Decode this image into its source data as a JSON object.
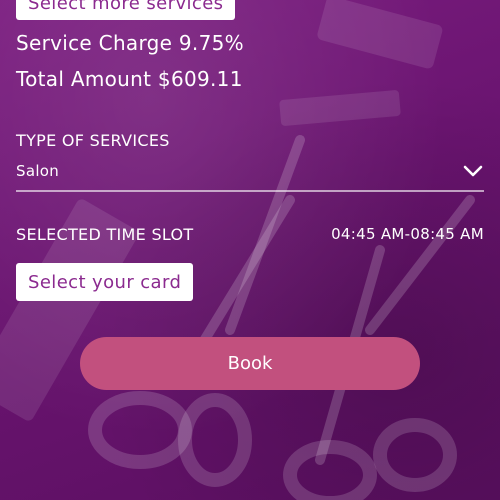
{
  "top_button": {
    "label": "Select more services"
  },
  "summary": {
    "service_charge": "Service Charge 9.75%",
    "total_amount": "Total Amount $609.11"
  },
  "services": {
    "label": "TYPE OF SERVICES",
    "selected": "Salon",
    "icon": "chevron-down-icon"
  },
  "time_slot": {
    "label": "SELECTED TIME SLOT",
    "value": "04:45 AM-08:45 AM"
  },
  "card_button": {
    "label": "Select your card"
  },
  "book_button": {
    "label": "Book"
  },
  "colors": {
    "background": "#6a1470",
    "accent_button": "#c2507e",
    "chip_text": "#8b2a8f"
  }
}
